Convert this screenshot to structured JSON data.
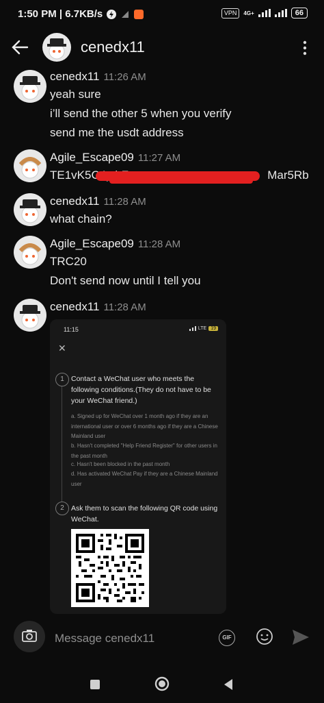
{
  "status": {
    "time_speed": "1:50 PM | 6.7KB/s",
    "vpn": "VPN",
    "net": "4G+",
    "battery": "66"
  },
  "header": {
    "title": "cenedx11"
  },
  "messages": [
    {
      "user": "cenedx11",
      "time": "11:26 AM",
      "lines": [
        "yeah sure",
        "i’ll send the other 5 when you verify",
        "send me the usdt address"
      ]
    },
    {
      "user": "Agile_Escape09",
      "time": "11:27 AM",
      "lines": [
        "TE1vK5C4ytbZ",
        "Mar5Rb"
      ]
    },
    {
      "user": "cenedx11",
      "time": "11:28 AM",
      "lines": [
        "what chain?"
      ]
    },
    {
      "user": "Agile_Escape09",
      "time": "11:28 AM",
      "lines": [
        "TRC20",
        "Don't send now until I tell you"
      ]
    },
    {
      "user": "cenedx11",
      "time": "11:28 AM",
      "lines": []
    }
  ],
  "attachment": {
    "time": "11:15",
    "net": "LTE",
    "battery": "19",
    "close": "✕",
    "step1_num": "1",
    "step1_title": "Contact a WeChat user who meets the following conditions.(They do not have to be your WeChat friend.)",
    "conditions": [
      "a. Signed up for WeChat over 1 month ago if they are an international user or over 6 months ago if they are a Chinese Mainland user",
      "b. Hasn't completed \"Help Friend Register\" for other users in the past month",
      "c. Hasn't been blocked in the past month",
      "d. Has activated WeChat Pay if they are a Chinese Mainland user"
    ],
    "step2_num": "2",
    "step2_title": "Ask them to scan the following QR code using WeChat."
  },
  "composer": {
    "placeholder": "Message cenedx11",
    "gif": "GIF"
  },
  "icons": [
    "back-arrow-icon",
    "more-vert-icon",
    "camera-icon",
    "gif-icon",
    "emoji-icon",
    "send-icon",
    "nav-recents-icon",
    "nav-home-icon",
    "nav-back-icon"
  ],
  "colors": {
    "background": "#0c0c0c",
    "redaction": "#e32020",
    "accent": "#ff6a2a"
  }
}
